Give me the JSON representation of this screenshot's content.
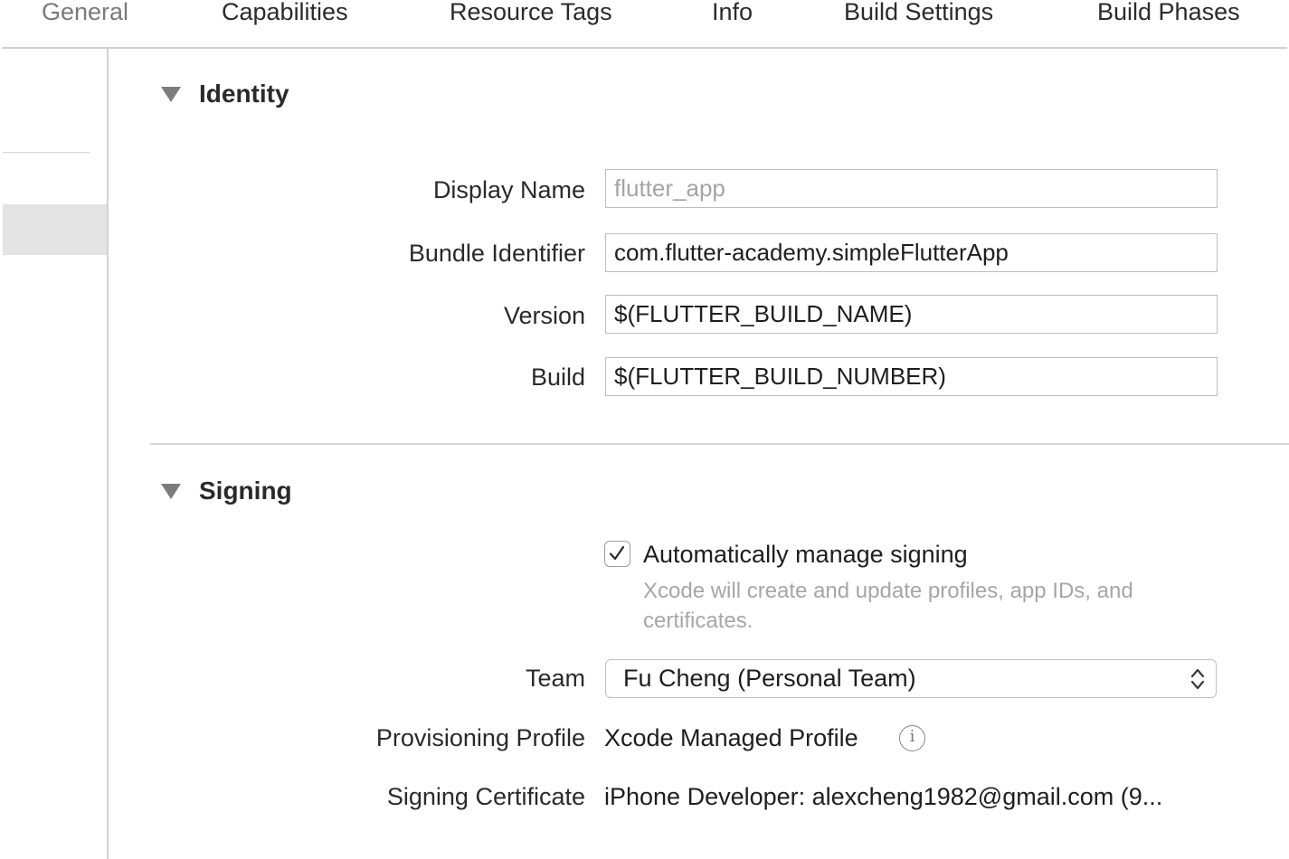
{
  "tabs": [
    {
      "label": "General",
      "selected": true
    },
    {
      "label": "Capabilities",
      "selected": false
    },
    {
      "label": "Resource Tags",
      "selected": false
    },
    {
      "label": "Info",
      "selected": false
    },
    {
      "label": "Build Settings",
      "selected": false
    },
    {
      "label": "Build Phases",
      "selected": false
    }
  ],
  "identity": {
    "title": "Identity",
    "display_name": {
      "label": "Display Name",
      "value": "",
      "placeholder": "flutter_app"
    },
    "bundle_identifier": {
      "label": "Bundle Identifier",
      "value": "com.flutter-academy.simpleFlutterApp"
    },
    "version": {
      "label": "Version",
      "value": "$(FLUTTER_BUILD_NAME)"
    },
    "build": {
      "label": "Build",
      "value": "$(FLUTTER_BUILD_NUMBER)"
    }
  },
  "signing": {
    "title": "Signing",
    "auto_manage": {
      "label": "Automatically manage signing",
      "checked": true
    },
    "help_text": "Xcode will create and update profiles, app IDs, and certificates.",
    "team": {
      "label": "Team",
      "value": "Fu Cheng (Personal Team)"
    },
    "provisioning_profile": {
      "label": "Provisioning Profile",
      "value": "Xcode Managed Profile"
    },
    "signing_certificate": {
      "label": "Signing Certificate",
      "value": "iPhone Developer: alexcheng1982@gmail.com (9..."
    }
  },
  "icons": {
    "disclosure": "disclosure-triangle-down-icon",
    "checkmark": "checkmark-icon",
    "popup_arrows": "chevron-up-down-icon",
    "info": "info-circle-icon"
  },
  "colors": {
    "selected_tab_text": "#7a7a7a",
    "placeholder_text": "#a4a4a4",
    "help_text": "#a6a6a6",
    "sidebar_selection": "#e3e3e3"
  }
}
